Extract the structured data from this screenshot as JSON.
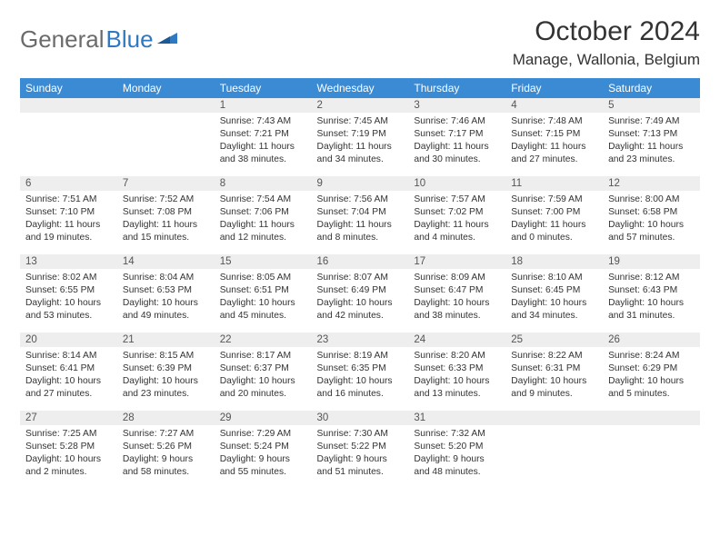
{
  "brand": {
    "part1": "General",
    "part2": "Blue"
  },
  "title": "October 2024",
  "location": "Manage, Wallonia, Belgium",
  "dayHeaders": [
    "Sunday",
    "Monday",
    "Tuesday",
    "Wednesday",
    "Thursday",
    "Friday",
    "Saturday"
  ],
  "weeks": [
    [
      null,
      null,
      {
        "n": "1",
        "sr": "Sunrise: 7:43 AM",
        "ss": "Sunset: 7:21 PM",
        "dl": "Daylight: 11 hours and 38 minutes."
      },
      {
        "n": "2",
        "sr": "Sunrise: 7:45 AM",
        "ss": "Sunset: 7:19 PM",
        "dl": "Daylight: 11 hours and 34 minutes."
      },
      {
        "n": "3",
        "sr": "Sunrise: 7:46 AM",
        "ss": "Sunset: 7:17 PM",
        "dl": "Daylight: 11 hours and 30 minutes."
      },
      {
        "n": "4",
        "sr": "Sunrise: 7:48 AM",
        "ss": "Sunset: 7:15 PM",
        "dl": "Daylight: 11 hours and 27 minutes."
      },
      {
        "n": "5",
        "sr": "Sunrise: 7:49 AM",
        "ss": "Sunset: 7:13 PM",
        "dl": "Daylight: 11 hours and 23 minutes."
      }
    ],
    [
      {
        "n": "6",
        "sr": "Sunrise: 7:51 AM",
        "ss": "Sunset: 7:10 PM",
        "dl": "Daylight: 11 hours and 19 minutes."
      },
      {
        "n": "7",
        "sr": "Sunrise: 7:52 AM",
        "ss": "Sunset: 7:08 PM",
        "dl": "Daylight: 11 hours and 15 minutes."
      },
      {
        "n": "8",
        "sr": "Sunrise: 7:54 AM",
        "ss": "Sunset: 7:06 PM",
        "dl": "Daylight: 11 hours and 12 minutes."
      },
      {
        "n": "9",
        "sr": "Sunrise: 7:56 AM",
        "ss": "Sunset: 7:04 PM",
        "dl": "Daylight: 11 hours and 8 minutes."
      },
      {
        "n": "10",
        "sr": "Sunrise: 7:57 AM",
        "ss": "Sunset: 7:02 PM",
        "dl": "Daylight: 11 hours and 4 minutes."
      },
      {
        "n": "11",
        "sr": "Sunrise: 7:59 AM",
        "ss": "Sunset: 7:00 PM",
        "dl": "Daylight: 11 hours and 0 minutes."
      },
      {
        "n": "12",
        "sr": "Sunrise: 8:00 AM",
        "ss": "Sunset: 6:58 PM",
        "dl": "Daylight: 10 hours and 57 minutes."
      }
    ],
    [
      {
        "n": "13",
        "sr": "Sunrise: 8:02 AM",
        "ss": "Sunset: 6:55 PM",
        "dl": "Daylight: 10 hours and 53 minutes."
      },
      {
        "n": "14",
        "sr": "Sunrise: 8:04 AM",
        "ss": "Sunset: 6:53 PM",
        "dl": "Daylight: 10 hours and 49 minutes."
      },
      {
        "n": "15",
        "sr": "Sunrise: 8:05 AM",
        "ss": "Sunset: 6:51 PM",
        "dl": "Daylight: 10 hours and 45 minutes."
      },
      {
        "n": "16",
        "sr": "Sunrise: 8:07 AM",
        "ss": "Sunset: 6:49 PM",
        "dl": "Daylight: 10 hours and 42 minutes."
      },
      {
        "n": "17",
        "sr": "Sunrise: 8:09 AM",
        "ss": "Sunset: 6:47 PM",
        "dl": "Daylight: 10 hours and 38 minutes."
      },
      {
        "n": "18",
        "sr": "Sunrise: 8:10 AM",
        "ss": "Sunset: 6:45 PM",
        "dl": "Daylight: 10 hours and 34 minutes."
      },
      {
        "n": "19",
        "sr": "Sunrise: 8:12 AM",
        "ss": "Sunset: 6:43 PM",
        "dl": "Daylight: 10 hours and 31 minutes."
      }
    ],
    [
      {
        "n": "20",
        "sr": "Sunrise: 8:14 AM",
        "ss": "Sunset: 6:41 PM",
        "dl": "Daylight: 10 hours and 27 minutes."
      },
      {
        "n": "21",
        "sr": "Sunrise: 8:15 AM",
        "ss": "Sunset: 6:39 PM",
        "dl": "Daylight: 10 hours and 23 minutes."
      },
      {
        "n": "22",
        "sr": "Sunrise: 8:17 AM",
        "ss": "Sunset: 6:37 PM",
        "dl": "Daylight: 10 hours and 20 minutes."
      },
      {
        "n": "23",
        "sr": "Sunrise: 8:19 AM",
        "ss": "Sunset: 6:35 PM",
        "dl": "Daylight: 10 hours and 16 minutes."
      },
      {
        "n": "24",
        "sr": "Sunrise: 8:20 AM",
        "ss": "Sunset: 6:33 PM",
        "dl": "Daylight: 10 hours and 13 minutes."
      },
      {
        "n": "25",
        "sr": "Sunrise: 8:22 AM",
        "ss": "Sunset: 6:31 PM",
        "dl": "Daylight: 10 hours and 9 minutes."
      },
      {
        "n": "26",
        "sr": "Sunrise: 8:24 AM",
        "ss": "Sunset: 6:29 PM",
        "dl": "Daylight: 10 hours and 5 minutes."
      }
    ],
    [
      {
        "n": "27",
        "sr": "Sunrise: 7:25 AM",
        "ss": "Sunset: 5:28 PM",
        "dl": "Daylight: 10 hours and 2 minutes."
      },
      {
        "n": "28",
        "sr": "Sunrise: 7:27 AM",
        "ss": "Sunset: 5:26 PM",
        "dl": "Daylight: 9 hours and 58 minutes."
      },
      {
        "n": "29",
        "sr": "Sunrise: 7:29 AM",
        "ss": "Sunset: 5:24 PM",
        "dl": "Daylight: 9 hours and 55 minutes."
      },
      {
        "n": "30",
        "sr": "Sunrise: 7:30 AM",
        "ss": "Sunset: 5:22 PM",
        "dl": "Daylight: 9 hours and 51 minutes."
      },
      {
        "n": "31",
        "sr": "Sunrise: 7:32 AM",
        "ss": "Sunset: 5:20 PM",
        "dl": "Daylight: 9 hours and 48 minutes."
      },
      null,
      null
    ]
  ]
}
